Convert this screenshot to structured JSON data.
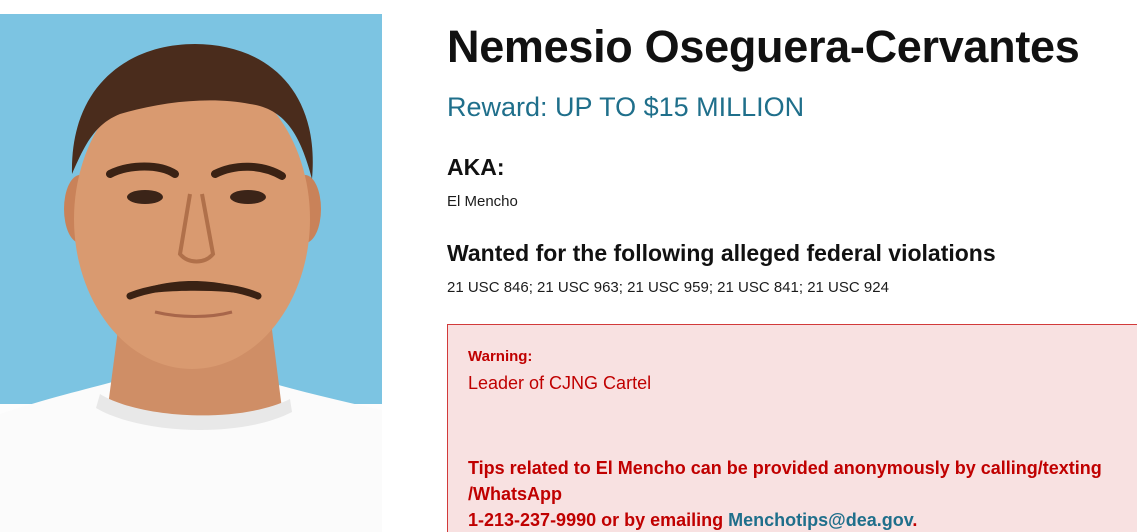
{
  "profile": {
    "name": "Nemesio Oseguera-Cervantes",
    "reward": "Reward: UP TO $15 MILLION",
    "aka_heading": "AKA:",
    "aka_value": "El Mencho",
    "violations_heading": "Wanted for the following alleged federal violations",
    "violations_value": "21 USC 846; 21 USC 963; 21 USC 959; 21 USC 841; 21 USC 924"
  },
  "warning": {
    "label": "Warning:",
    "text": "Leader of CJNG Cartel",
    "tips_line1": "Tips related to El Mencho can be provided anonymously by calling/texting /WhatsApp",
    "tips_phone_prefix": "1-213-237-9990 or by emailing ",
    "tips_email": "Menchotips@dea.gov",
    "tips_suffix": "."
  },
  "colors": {
    "reward": "#1f6f8b",
    "warning_text": "#c00000",
    "warning_bg": "#f8e1e1",
    "warning_border": "#d23a3a",
    "photo_bg": "#7cc4e2"
  }
}
